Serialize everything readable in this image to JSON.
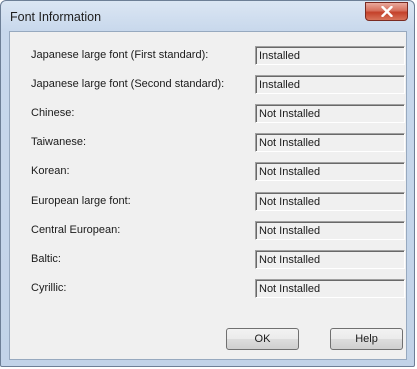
{
  "window": {
    "title": "Font Information",
    "close_icon": "close-x-icon"
  },
  "fonts": [
    {
      "label": "Japanese large font (First standard):",
      "status": "Installed"
    },
    {
      "label": "Japanese large font (Second standard):",
      "status": "Installed"
    },
    {
      "label": "Chinese:",
      "status": "Not Installed"
    },
    {
      "label": "Taiwanese:",
      "status": "Not Installed"
    },
    {
      "label": "Korean:",
      "status": "Not Installed"
    },
    {
      "label": "European large font:",
      "status": "Not Installed"
    },
    {
      "label": "Central European:",
      "status": "Not Installed"
    },
    {
      "label": "Baltic:",
      "status": "Not Installed"
    },
    {
      "label": "Cyrillic:",
      "status": "Not Installed"
    }
  ],
  "buttons": {
    "ok_label": "OK",
    "help_label": "Help"
  },
  "colors": {
    "close_button": "#c4412a",
    "dialog_face": "#f0f0f0",
    "frame": "#c2d3e8"
  }
}
